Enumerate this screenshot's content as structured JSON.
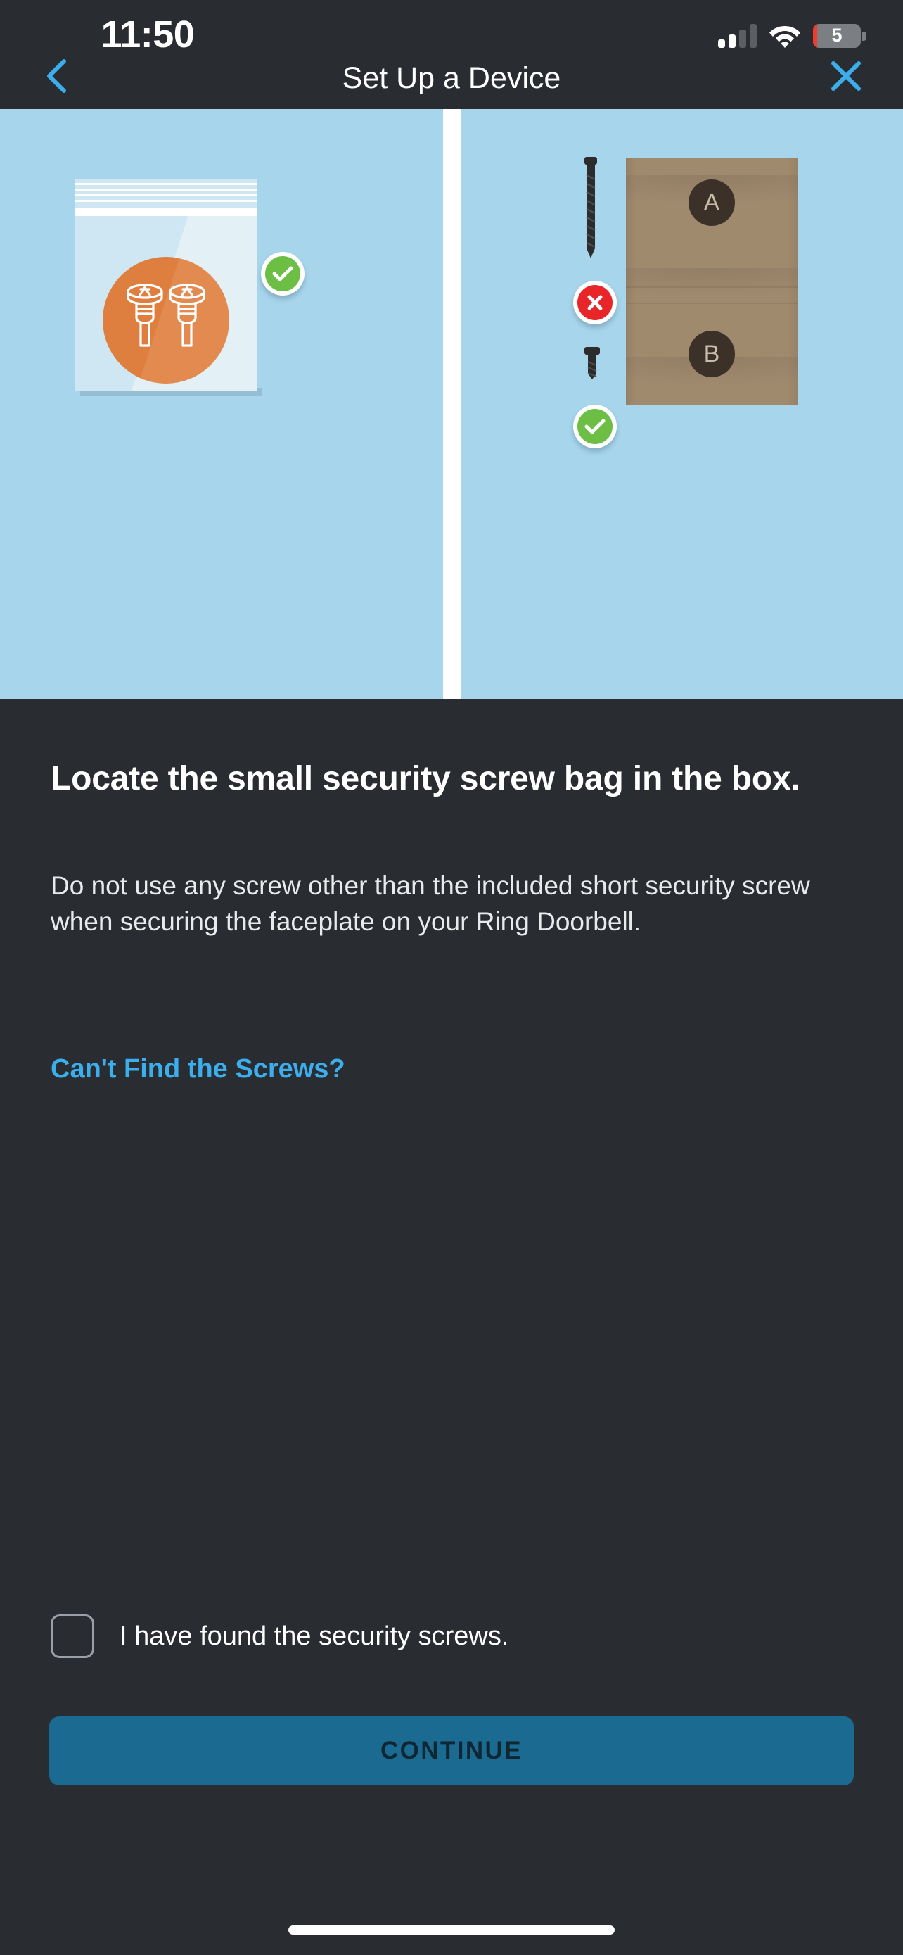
{
  "status_bar": {
    "time": "11:50",
    "signal_icon": "cellular-signal-icon",
    "signal_bars_filled": 2,
    "signal_bars_total": 4,
    "wifi_icon": "wifi-icon",
    "battery_icon": "battery-icon",
    "battery_level": "5",
    "battery_low_color": "#F03B2D"
  },
  "nav": {
    "back_icon": "chevron-left-icon",
    "title": "Set Up a Device",
    "close_icon": "close-x-icon",
    "accent_color": "#3BAEEB"
  },
  "illustration": {
    "background_color": "#A6D5EC",
    "left_panel": {
      "name": "security-screw-bag-illustration",
      "bag_icon": "ziplock-bag-icon",
      "screws_icon": "two-short-screws-icon",
      "highlight_color": "#DF7F3F",
      "badge": {
        "icon": "check-badge-icon",
        "state": "correct",
        "color": "#6CBE45"
      }
    },
    "right_panel": {
      "name": "screw-comparison-illustration",
      "long_screw": {
        "icon": "long-screw-icon",
        "badge_icon": "x-badge-icon",
        "state": "incorrect",
        "color": "#E8262A"
      },
      "short_screw": {
        "icon": "short-security-screw-icon",
        "badge_icon": "check-badge-icon",
        "state": "correct",
        "color": "#6CBE45"
      },
      "envelope": {
        "icon": "cardboard-envelope-icon",
        "color": "#A08A6E",
        "labels": [
          "A",
          "B"
        ]
      }
    }
  },
  "content": {
    "title": "Locate the small security screw bag in the box.",
    "body": "Do not use any screw other than the included short security screw when securing the faceplate on your Ring Doorbell.",
    "help_link": "Can't Find the Screws?"
  },
  "bottom": {
    "checkbox_label": "I have found the security screws.",
    "checkbox_checked": false,
    "continue_label": "CONTINUE",
    "continue_color": "#1A6A91",
    "continue_enabled": false
  }
}
